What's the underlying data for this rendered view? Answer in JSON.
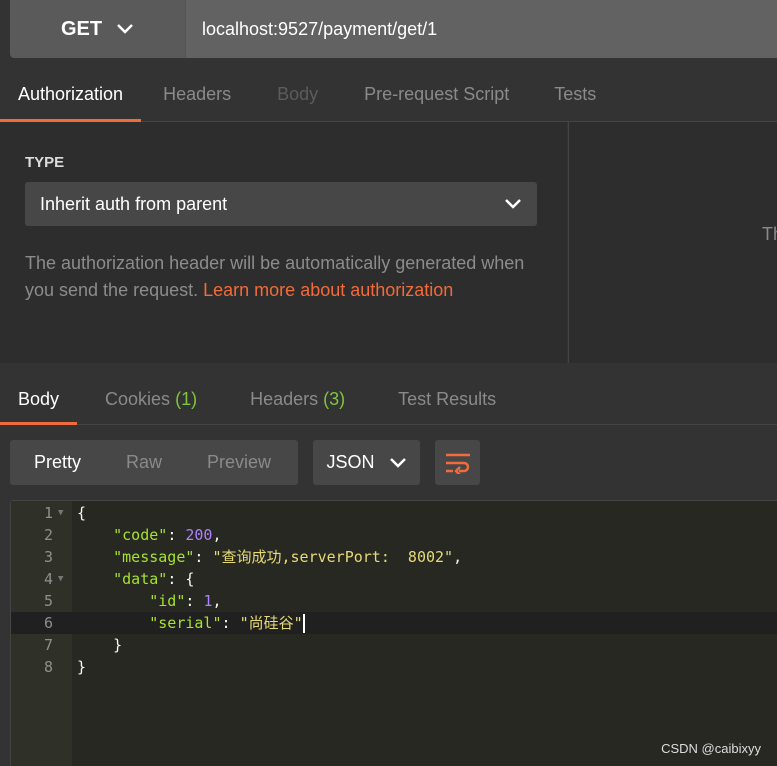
{
  "request": {
    "method": "GET",
    "url": "localhost:9527/payment/get/1"
  },
  "request_tabs": [
    "Authorization",
    "Headers",
    "Body",
    "Pre-request Script",
    "Tests"
  ],
  "auth": {
    "type_label": "TYPE",
    "type_value": "Inherit auth from parent",
    "description": "The authorization header will be automatically generated when you send the request.",
    "link": "Learn more about authorization",
    "right_panel_text": "Th"
  },
  "response_tabs": [
    {
      "label": "Body"
    },
    {
      "label": "Cookies",
      "count": "(1)"
    },
    {
      "label": "Headers",
      "count": "(3)"
    },
    {
      "label": "Test Results"
    }
  ],
  "view_modes": [
    "Pretty",
    "Raw",
    "Preview"
  ],
  "format": "JSON",
  "code": {
    "l1": "{",
    "k_code": "\"code\"",
    "v_code": "200",
    "k_message": "\"message\"",
    "v_message": "\"查询成功,serverPort:  8002\"",
    "k_data": "\"data\"",
    "k_id": "\"id\"",
    "v_id": "1",
    "k_serial": "\"serial\"",
    "v_serial": "\"尚硅谷\"",
    "l7": "}",
    "l8": "}"
  },
  "watermark": "CSDN @caibixyy",
  "colors": {
    "accent": "#f26b3a",
    "count": "#7ec53f"
  }
}
